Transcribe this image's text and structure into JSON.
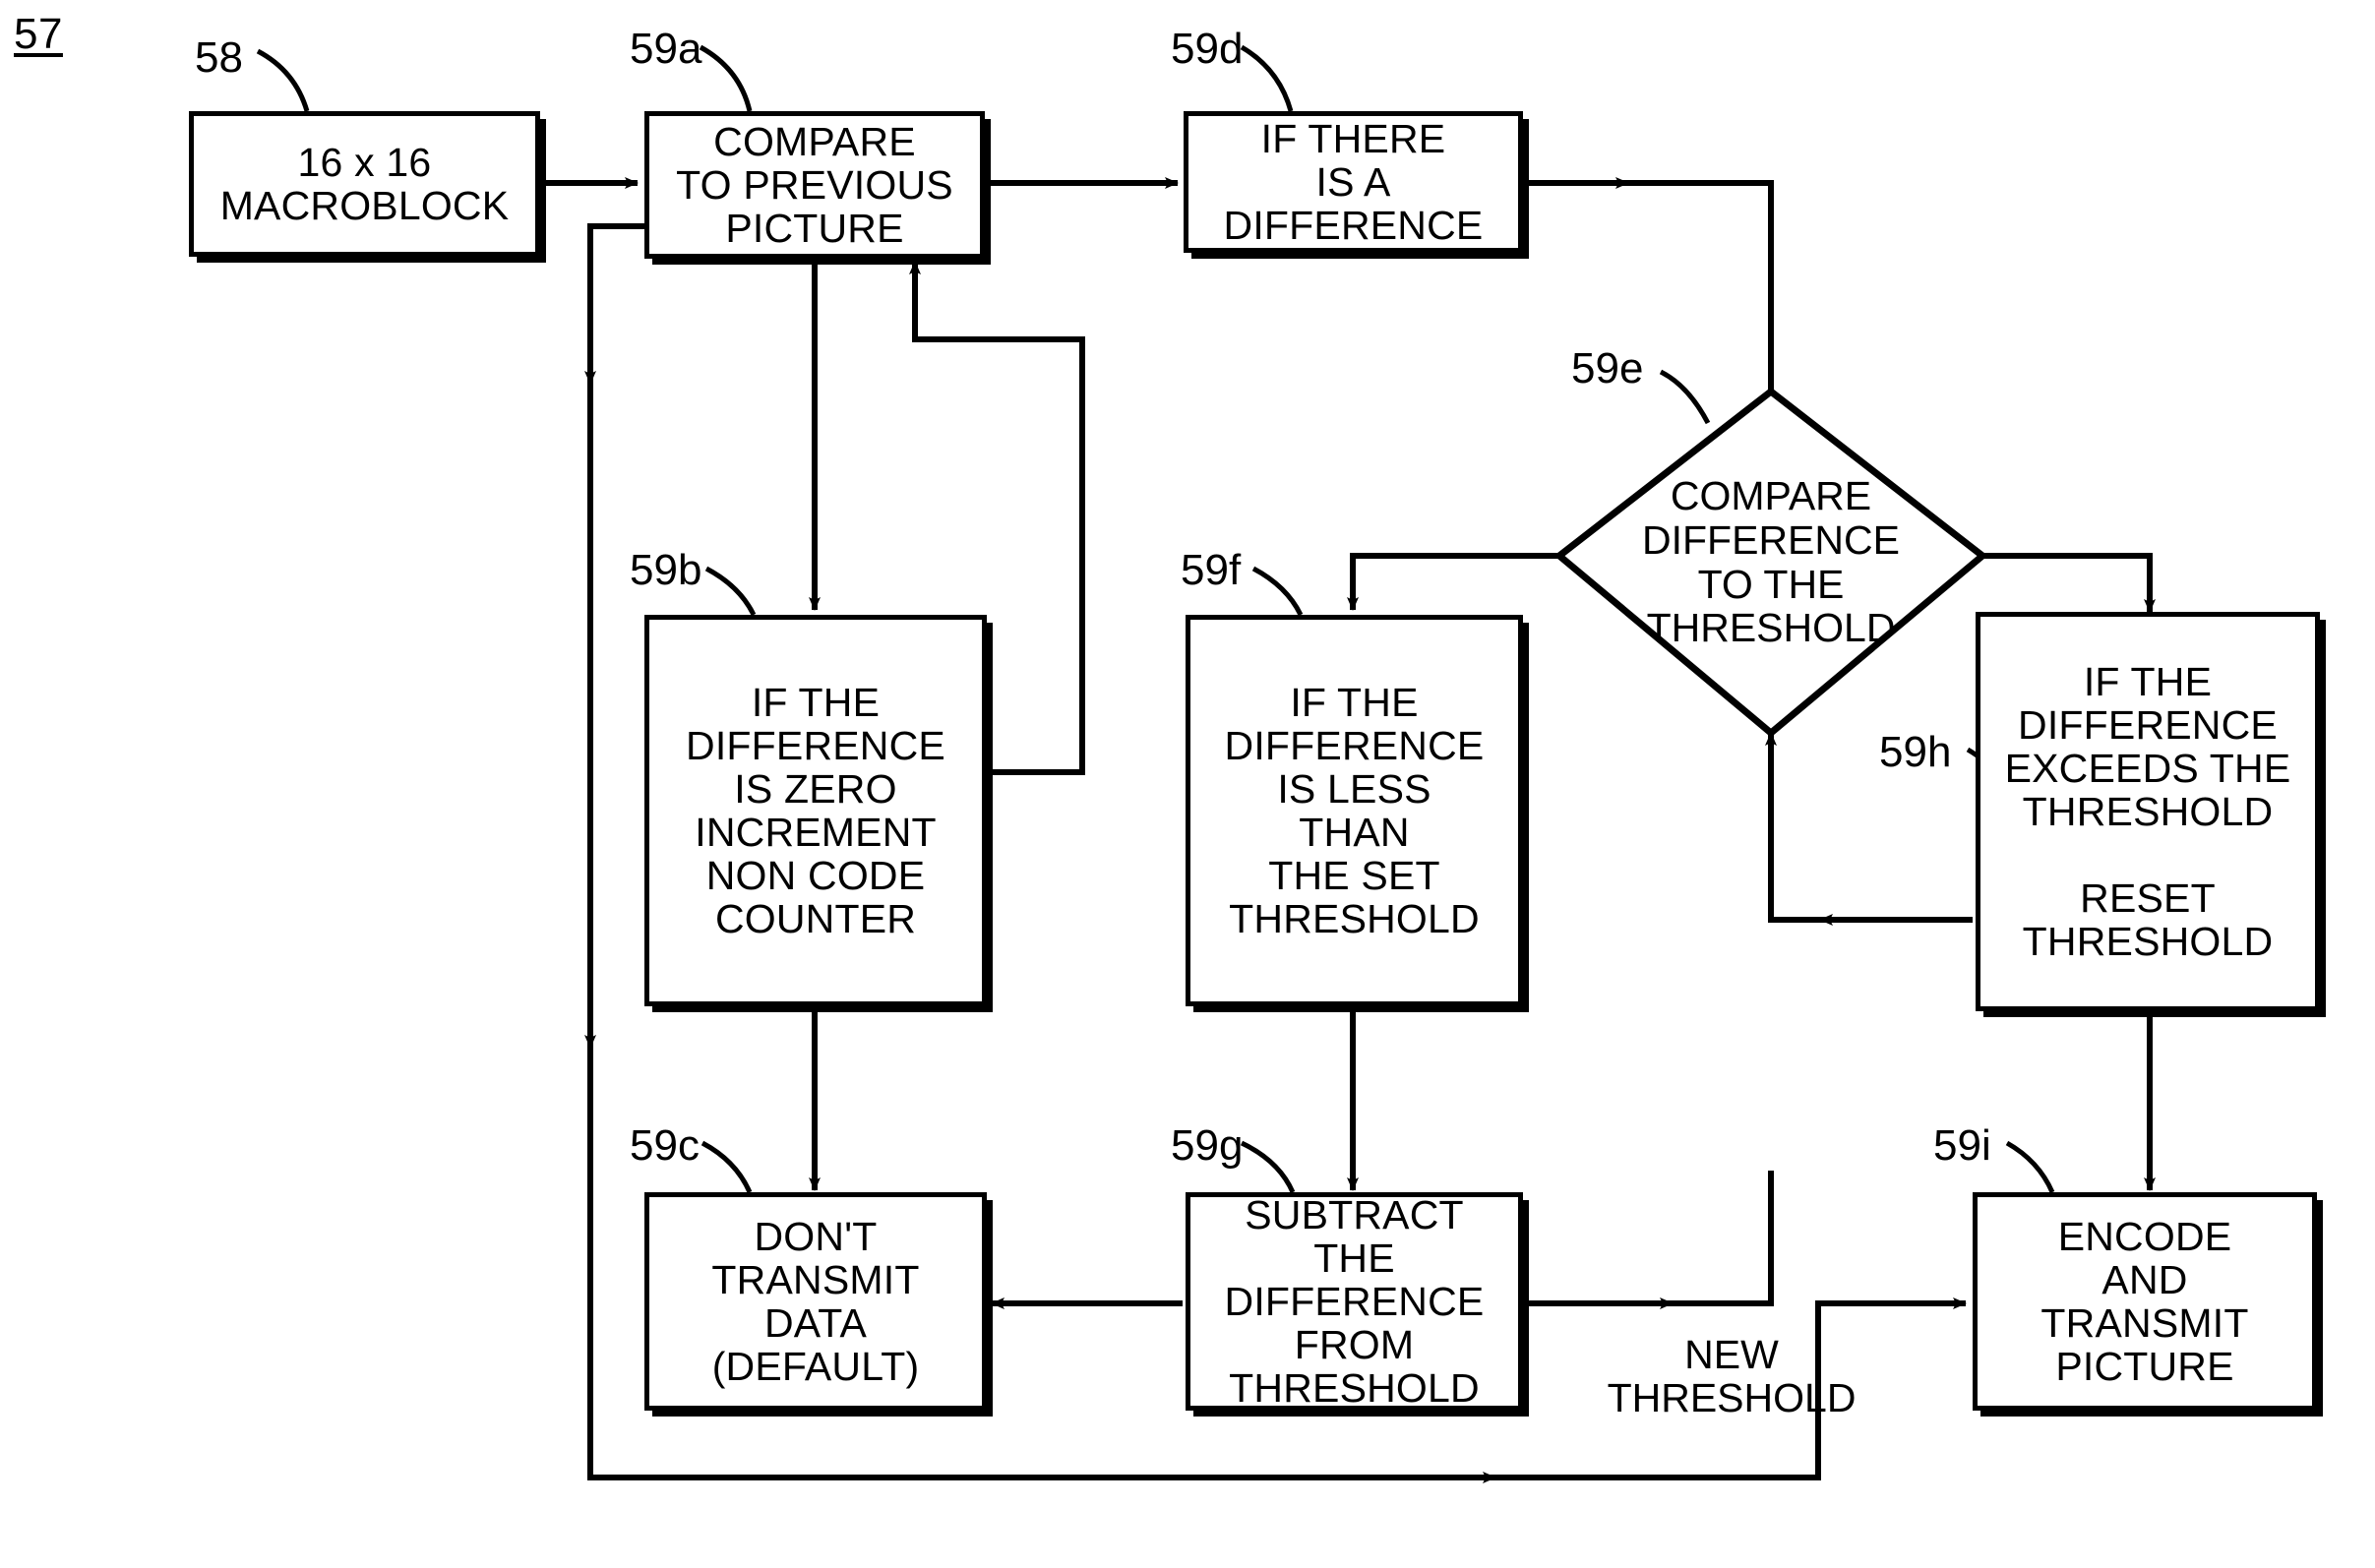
{
  "figure": {
    "number": "57"
  },
  "nodes": [
    {
      "ref": "58",
      "text": "16 x 16\nMACROBLOCK"
    },
    {
      "ref": "59a",
      "text": "COMPARE\nTO PREVIOUS\nPICTURE"
    },
    {
      "ref": "59d",
      "text": "IF THERE\nIS A\nDIFFERENCE"
    },
    {
      "ref": "59e",
      "text": "COMPARE\nDIFFERENCE\nTO THE\nTHRESHOLD"
    },
    {
      "ref": "59b",
      "text": "IF THE\nDIFFERENCE\nIS ZERO\nINCREMENT\nNON CODE\nCOUNTER"
    },
    {
      "ref": "59f",
      "text": "IF THE\nDIFFERENCE\nIS LESS\nTHAN\nTHE SET\nTHRESHOLD"
    },
    {
      "ref": "59h",
      "text": "IF THE\nDIFFERENCE\nEXCEEDS THE\nTHRESHOLD\n\nRESET\nTHRESHOLD"
    },
    {
      "ref": "59c",
      "text": "DON'T\nTRANSMIT\nDATA\n(DEFAULT)"
    },
    {
      "ref": "59g",
      "text": "SUBTRACT\nTHE\nDIFFERENCE\nFROM\nTHRESHOLD"
    },
    {
      "ref": "59i",
      "text": "ENCODE\nAND\nTRANSMIT\nPICTURE"
    }
  ],
  "edge_labels": [
    {
      "text": "NEW\nTHRESHOLD"
    }
  ],
  "colors": {
    "ink": "#000000",
    "paper": "#ffffff"
  }
}
